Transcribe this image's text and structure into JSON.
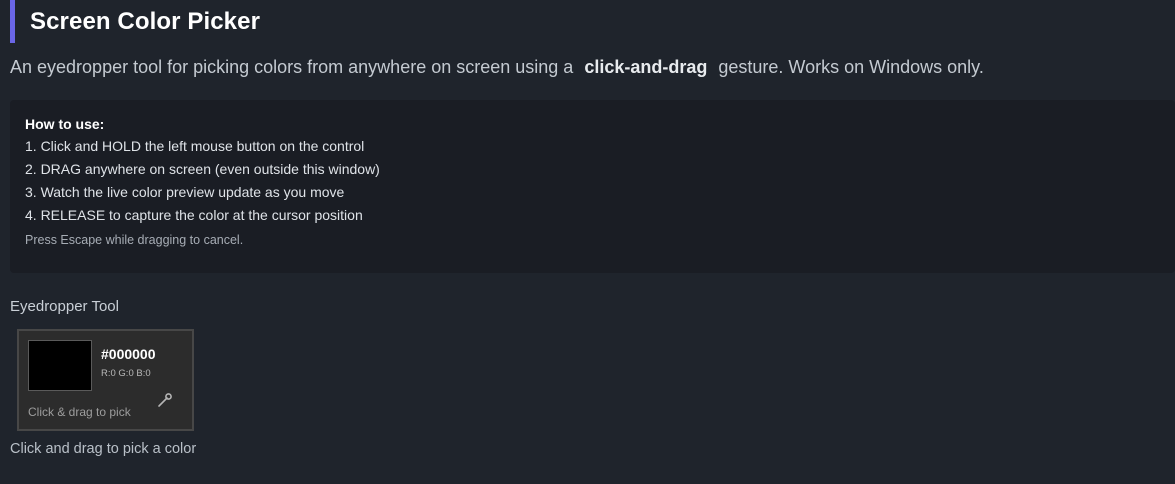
{
  "header": {
    "title": "Screen Color Picker",
    "accent_color": "#6a66e6"
  },
  "intro": {
    "before": "An eyedropper tool for picking colors from anywhere on screen using a",
    "emphasis": "click-and-drag",
    "after": "gesture. Works on Windows only."
  },
  "howto": {
    "heading": "How to use:",
    "steps": [
      "1. Click and HOLD the left mouse button on the control",
      "2. DRAG anywhere on screen (even outside this window)",
      "3. Watch the live color preview update as you move",
      "4. RELEASE to capture the color at the cursor position"
    ],
    "note": "Press Escape while dragging to cancel."
  },
  "tool": {
    "label": "Eyedropper Tool",
    "swatch_color": "#000000",
    "hex": "#000000",
    "rgb": "R:0 G:0 B:0",
    "hint": "Click & drag to pick",
    "icon": "eyedropper-icon"
  },
  "status": "Click and drag to pick a color"
}
